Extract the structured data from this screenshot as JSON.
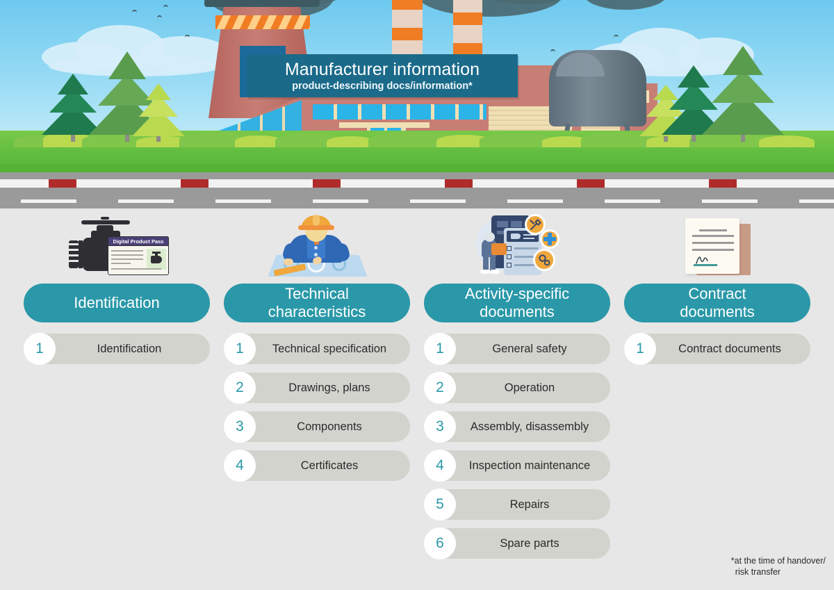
{
  "banner": {
    "title": "Manufacturer information",
    "subtitle": "product-describing docs/information*"
  },
  "colors": {
    "teal_header": "#2a98a8",
    "banner_blue": "#1b6a8a",
    "pill_grey": "#d2d3cd",
    "page_background": "#e8e7e7",
    "number_text": "#2a98a8"
  },
  "columns": [
    {
      "icon": "valve-digital-product-pass-icon",
      "icon_label": "Digital Product Pass",
      "header": "Identification",
      "items": [
        {
          "number": "1",
          "label": "Identification"
        }
      ]
    },
    {
      "icon": "engineer-blueprint-icon",
      "header": "Technical\ncharacteristics",
      "header_line1": "Technical",
      "header_line2": "characteristics",
      "items": [
        {
          "number": "1",
          "label": "Technical specification"
        },
        {
          "number": "2",
          "label": "Drawings, plans"
        },
        {
          "number": "3",
          "label": "Components"
        },
        {
          "number": "4",
          "label": "Certificates"
        }
      ]
    },
    {
      "icon": "clipboard-checklist-icon",
      "header": "Activity-specific\ndocuments",
      "header_line1": "Activity-specific",
      "header_line2": "documents",
      "items": [
        {
          "number": "1",
          "label": "General safety"
        },
        {
          "number": "2",
          "label": "Operation"
        },
        {
          "number": "3",
          "label": "Assembly, disassembly"
        },
        {
          "number": "4",
          "label": "Inspection maintenance"
        },
        {
          "number": "5",
          "label": "Repairs"
        },
        {
          "number": "6",
          "label": "Spare parts"
        }
      ]
    },
    {
      "icon": "signed-contract-icon",
      "header": "Contract\ndocuments",
      "header_line1": "Contract",
      "header_line2": "documents",
      "items": [
        {
          "number": "1",
          "label": "Contract documents"
        }
      ]
    }
  ],
  "footnote": {
    "line1": "*at the time of handover/",
    "line2": "risk transfer"
  }
}
